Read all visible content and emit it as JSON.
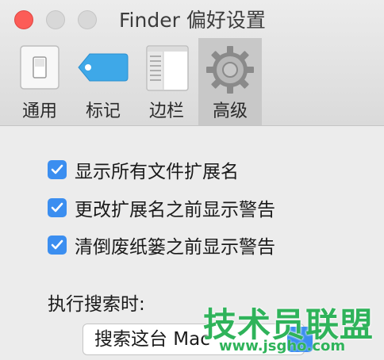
{
  "window": {
    "title": "Finder 偏好设置"
  },
  "toolbar": {
    "tabs": [
      {
        "label": "通用",
        "icon": "switch-icon"
      },
      {
        "label": "标记",
        "icon": "tag-icon"
      },
      {
        "label": "边栏",
        "icon": "sidebar-icon"
      },
      {
        "label": "高级",
        "icon": "gear-icon",
        "selected": true
      }
    ]
  },
  "options": {
    "checkboxes": [
      {
        "label": "显示所有文件扩展名",
        "checked": true
      },
      {
        "label": "更改扩展名之前显示警告",
        "checked": true
      },
      {
        "label": "清倒废纸篓之前显示警告",
        "checked": true
      }
    ],
    "search_label": "执行搜索时:",
    "search_select_value": "搜索这台 Mac"
  },
  "watermark": {
    "text": "技术员联盟",
    "url": "www.jsgho.com"
  },
  "colors": {
    "accent": "#3b8ef0",
    "close": "#fc5c57",
    "watermark": "#2fb35a"
  }
}
